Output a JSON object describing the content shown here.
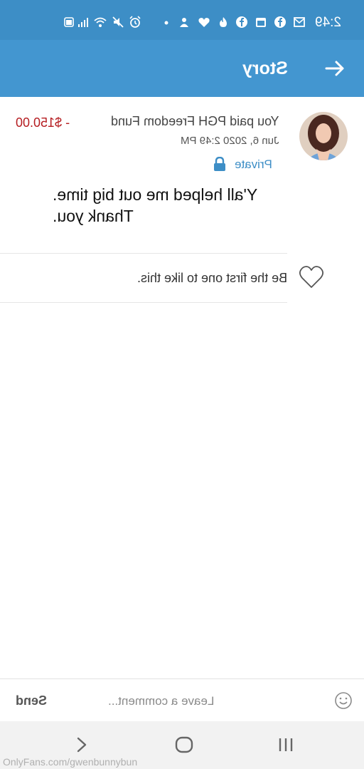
{
  "status_bar": {
    "time": "2:49"
  },
  "header": {
    "title": "Story"
  },
  "post": {
    "meta": "You paid PGH Freedom Fund",
    "amount": "- $150.00",
    "date": "Jun 6, 2020 2:49 PM",
    "privacy": "Private",
    "text_lines": [
      "Y'all helped me out big time.",
      "Thank you."
    ]
  },
  "likes": {
    "text": "Be the first one to like this."
  },
  "comment_bar": {
    "placeholder": "Leave a comment...",
    "send_label": "Send"
  },
  "watermark": "OnlyFans.com/gwenbunnybun",
  "colors": {
    "header": "#4396d0",
    "status_bar": "#3d8ec6",
    "accent": "#3d8ec6",
    "amount": "#b51d21"
  },
  "icons": {
    "status_bar": [
      "battery-icon",
      "signal-icon",
      "wifi-icon",
      "mute-icon",
      "alarm-icon",
      "dot-icon",
      "notification-icon",
      "heart-icon",
      "flame-icon",
      "facebook-icon",
      "calendar-icon",
      "facebook-icon",
      "mail-icon"
    ],
    "header": "back-arrow-icon",
    "privacy": "lock-icon",
    "like": "heart-outline-icon",
    "comment": "emoji-icon",
    "nav": [
      "recents-icon",
      "home-icon",
      "back-icon"
    ]
  }
}
